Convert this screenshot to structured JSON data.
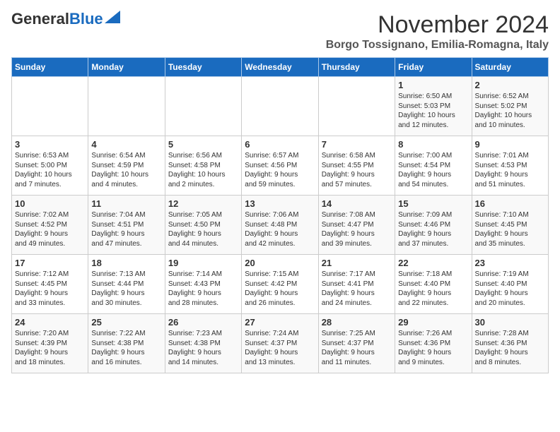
{
  "header": {
    "logo_general": "General",
    "logo_blue": "Blue",
    "month_title": "November 2024",
    "location": "Borgo Tossignano, Emilia-Romagna, Italy"
  },
  "weekdays": [
    "Sunday",
    "Monday",
    "Tuesday",
    "Wednesday",
    "Thursday",
    "Friday",
    "Saturday"
  ],
  "weeks": [
    [
      {
        "day": "",
        "info": ""
      },
      {
        "day": "",
        "info": ""
      },
      {
        "day": "",
        "info": ""
      },
      {
        "day": "",
        "info": ""
      },
      {
        "day": "",
        "info": ""
      },
      {
        "day": "1",
        "info": "Sunrise: 6:50 AM\nSunset: 5:03 PM\nDaylight: 10 hours\nand 12 minutes."
      },
      {
        "day": "2",
        "info": "Sunrise: 6:52 AM\nSunset: 5:02 PM\nDaylight: 10 hours\nand 10 minutes."
      }
    ],
    [
      {
        "day": "3",
        "info": "Sunrise: 6:53 AM\nSunset: 5:00 PM\nDaylight: 10 hours\nand 7 minutes."
      },
      {
        "day": "4",
        "info": "Sunrise: 6:54 AM\nSunset: 4:59 PM\nDaylight: 10 hours\nand 4 minutes."
      },
      {
        "day": "5",
        "info": "Sunrise: 6:56 AM\nSunset: 4:58 PM\nDaylight: 10 hours\nand 2 minutes."
      },
      {
        "day": "6",
        "info": "Sunrise: 6:57 AM\nSunset: 4:56 PM\nDaylight: 9 hours\nand 59 minutes."
      },
      {
        "day": "7",
        "info": "Sunrise: 6:58 AM\nSunset: 4:55 PM\nDaylight: 9 hours\nand 57 minutes."
      },
      {
        "day": "8",
        "info": "Sunrise: 7:00 AM\nSunset: 4:54 PM\nDaylight: 9 hours\nand 54 minutes."
      },
      {
        "day": "9",
        "info": "Sunrise: 7:01 AM\nSunset: 4:53 PM\nDaylight: 9 hours\nand 51 minutes."
      }
    ],
    [
      {
        "day": "10",
        "info": "Sunrise: 7:02 AM\nSunset: 4:52 PM\nDaylight: 9 hours\nand 49 minutes."
      },
      {
        "day": "11",
        "info": "Sunrise: 7:04 AM\nSunset: 4:51 PM\nDaylight: 9 hours\nand 47 minutes."
      },
      {
        "day": "12",
        "info": "Sunrise: 7:05 AM\nSunset: 4:50 PM\nDaylight: 9 hours\nand 44 minutes."
      },
      {
        "day": "13",
        "info": "Sunrise: 7:06 AM\nSunset: 4:48 PM\nDaylight: 9 hours\nand 42 minutes."
      },
      {
        "day": "14",
        "info": "Sunrise: 7:08 AM\nSunset: 4:47 PM\nDaylight: 9 hours\nand 39 minutes."
      },
      {
        "day": "15",
        "info": "Sunrise: 7:09 AM\nSunset: 4:46 PM\nDaylight: 9 hours\nand 37 minutes."
      },
      {
        "day": "16",
        "info": "Sunrise: 7:10 AM\nSunset: 4:45 PM\nDaylight: 9 hours\nand 35 minutes."
      }
    ],
    [
      {
        "day": "17",
        "info": "Sunrise: 7:12 AM\nSunset: 4:45 PM\nDaylight: 9 hours\nand 33 minutes."
      },
      {
        "day": "18",
        "info": "Sunrise: 7:13 AM\nSunset: 4:44 PM\nDaylight: 9 hours\nand 30 minutes."
      },
      {
        "day": "19",
        "info": "Sunrise: 7:14 AM\nSunset: 4:43 PM\nDaylight: 9 hours\nand 28 minutes."
      },
      {
        "day": "20",
        "info": "Sunrise: 7:15 AM\nSunset: 4:42 PM\nDaylight: 9 hours\nand 26 minutes."
      },
      {
        "day": "21",
        "info": "Sunrise: 7:17 AM\nSunset: 4:41 PM\nDaylight: 9 hours\nand 24 minutes."
      },
      {
        "day": "22",
        "info": "Sunrise: 7:18 AM\nSunset: 4:40 PM\nDaylight: 9 hours\nand 22 minutes."
      },
      {
        "day": "23",
        "info": "Sunrise: 7:19 AM\nSunset: 4:40 PM\nDaylight: 9 hours\nand 20 minutes."
      }
    ],
    [
      {
        "day": "24",
        "info": "Sunrise: 7:20 AM\nSunset: 4:39 PM\nDaylight: 9 hours\nand 18 minutes."
      },
      {
        "day": "25",
        "info": "Sunrise: 7:22 AM\nSunset: 4:38 PM\nDaylight: 9 hours\nand 16 minutes."
      },
      {
        "day": "26",
        "info": "Sunrise: 7:23 AM\nSunset: 4:38 PM\nDaylight: 9 hours\nand 14 minutes."
      },
      {
        "day": "27",
        "info": "Sunrise: 7:24 AM\nSunset: 4:37 PM\nDaylight: 9 hours\nand 13 minutes."
      },
      {
        "day": "28",
        "info": "Sunrise: 7:25 AM\nSunset: 4:37 PM\nDaylight: 9 hours\nand 11 minutes."
      },
      {
        "day": "29",
        "info": "Sunrise: 7:26 AM\nSunset: 4:36 PM\nDaylight: 9 hours\nand 9 minutes."
      },
      {
        "day": "30",
        "info": "Sunrise: 7:28 AM\nSunset: 4:36 PM\nDaylight: 9 hours\nand 8 minutes."
      }
    ]
  ]
}
